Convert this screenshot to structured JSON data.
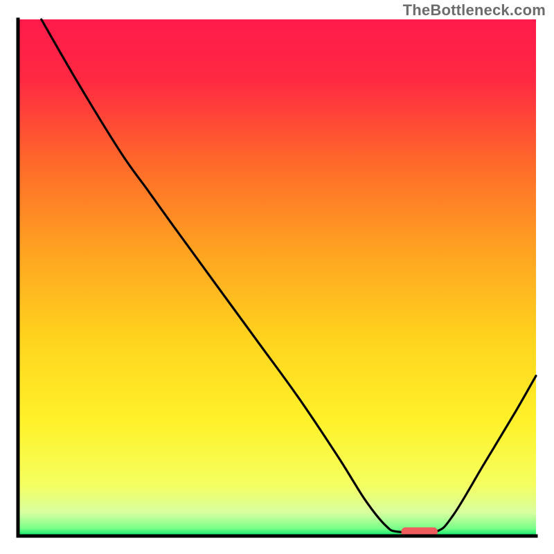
{
  "watermark": "TheBottleneck.com",
  "colors": {
    "gradient_stops": [
      {
        "offset": 0.0,
        "color": "#ff1a4b"
      },
      {
        "offset": 0.12,
        "color": "#ff2a42"
      },
      {
        "offset": 0.28,
        "color": "#ff6a2a"
      },
      {
        "offset": 0.45,
        "color": "#ffa321"
      },
      {
        "offset": 0.62,
        "color": "#ffd41e"
      },
      {
        "offset": 0.78,
        "color": "#fff22a"
      },
      {
        "offset": 0.9,
        "color": "#f5ff60"
      },
      {
        "offset": 0.955,
        "color": "#d8ffa0"
      },
      {
        "offset": 0.985,
        "color": "#7aff8a"
      },
      {
        "offset": 1.0,
        "color": "#00e765"
      }
    ],
    "curve": "#000000",
    "frame": "#000000",
    "marker": "#ef5c5c",
    "marker_border": "#c94444"
  },
  "chart_data": {
    "type": "line",
    "title": "",
    "xlabel": "",
    "ylabel": "",
    "xlim": [
      0,
      100
    ],
    "ylim": [
      0,
      100
    ],
    "note": "x/y in percent of plot area; y=0 is the baseline (best / no bottleneck), larger y = worse bottleneck. Values are estimated from pixel positions.",
    "curve_points": [
      {
        "x": 4.5,
        "y": 100.0
      },
      {
        "x": 12.0,
        "y": 87.0
      },
      {
        "x": 20.0,
        "y": 74.0
      },
      {
        "x": 25.0,
        "y": 67.0
      },
      {
        "x": 30.0,
        "y": 60.0
      },
      {
        "x": 38.0,
        "y": 49.0
      },
      {
        "x": 46.0,
        "y": 38.0
      },
      {
        "x": 54.0,
        "y": 27.0
      },
      {
        "x": 62.0,
        "y": 15.0
      },
      {
        "x": 67.0,
        "y": 7.0
      },
      {
        "x": 71.0,
        "y": 2.0
      },
      {
        "x": 73.5,
        "y": 0.8
      },
      {
        "x": 80.5,
        "y": 0.8
      },
      {
        "x": 84.0,
        "y": 4.0
      },
      {
        "x": 90.0,
        "y": 14.0
      },
      {
        "x": 96.0,
        "y": 24.0
      },
      {
        "x": 100.0,
        "y": 31.0
      }
    ],
    "optimal_marker": {
      "x_start": 74.0,
      "x_end": 81.0,
      "y": 0.8
    }
  }
}
